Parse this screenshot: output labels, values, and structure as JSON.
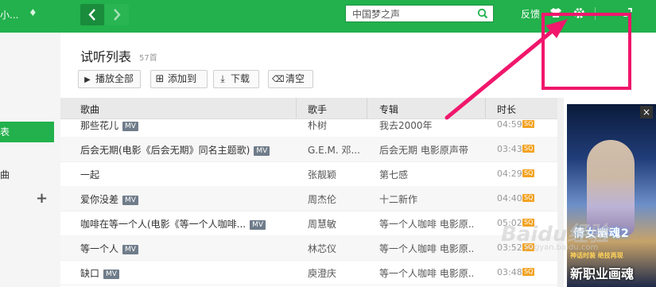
{
  "topbar": {
    "user_label": "小...",
    "search_value": "中国梦之声",
    "feedback": "反馈",
    "icons": [
      "diamond-icon",
      "back-icon",
      "forward-icon",
      "search-icon",
      "skin-icon",
      "settings-icon",
      "minimize-icon",
      "restore-icon"
    ],
    "accent": "#22b14c"
  },
  "sidebar": {
    "active_label": "表",
    "item2_label": "曲",
    "add_label": "+"
  },
  "playlist": {
    "title": "试听列表",
    "count": "57首",
    "buttons": {
      "play_all": "播放全部",
      "add_to": "添加到",
      "download": "下载",
      "clear": "清空"
    }
  },
  "table": {
    "headers": {
      "song": "歌曲",
      "singer": "歌手",
      "album": "专辑",
      "duration": "时长"
    },
    "mv_badge": "MV",
    "sq_badge": "SQ",
    "rows": [
      {
        "song": "那些花儿",
        "mv": "MV",
        "singer": "朴树",
        "album": "我去2000年",
        "duration": "04:59",
        "sq": "SQ"
      },
      {
        "song": "后会无期(电影《后会无期》同名主题歌)",
        "mv": "MV",
        "singer": "G.E.M. 邓...",
        "album": "后会无期 电影原声带",
        "duration": "03:43",
        "sq": "SQ"
      },
      {
        "song": "一起",
        "mv": "",
        "singer": "张靓颖",
        "album": "第七感",
        "duration": "04:29",
        "sq": "SQ"
      },
      {
        "song": "爱你没差",
        "mv": "MV",
        "singer": "周杰伦",
        "album": "十二新作",
        "duration": "04:40",
        "sq": "SQ"
      },
      {
        "song": "咖啡在等一个人(电影《等一个人咖啡...",
        "mv": "MV",
        "singer": "周慧敏",
        "album": "等一个人咖啡 电影原...",
        "duration": "05:02",
        "sq": "SQ"
      },
      {
        "song": "等一个人",
        "mv": "MV",
        "singer": "林芯仪",
        "album": "等一个人咖啡 电影原...",
        "duration": "03:52",
        "sq": "SQ"
      },
      {
        "song": "缺口",
        "mv": "MV",
        "singer": "庾澄庆",
        "album": "等一个人咖啡 电影原...",
        "duration": "03:48",
        "sq": "SQ"
      }
    ]
  },
  "ad": {
    "close": "×",
    "logo": "倩女幽魂2",
    "subline": "神话时装 绝技再现",
    "big_text": "新职业画魂"
  },
  "watermark": {
    "text": "Baidu经验",
    "sub": "jingyan.baidu.com"
  }
}
